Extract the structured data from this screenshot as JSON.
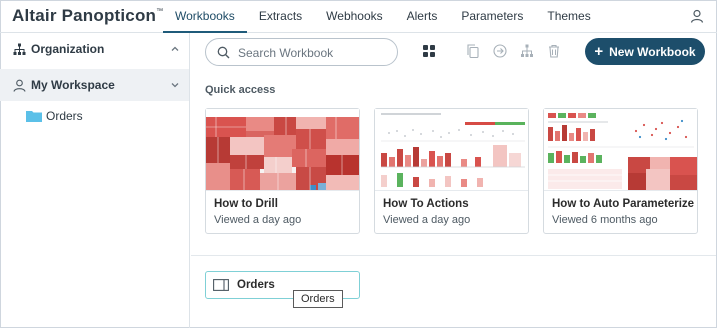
{
  "app": {
    "brand": "Altair Panopticon",
    "trademark": "™"
  },
  "tabs": [
    {
      "label": "Workbooks",
      "active": true
    },
    {
      "label": "Extracts"
    },
    {
      "label": "Webhooks"
    },
    {
      "label": "Alerts"
    },
    {
      "label": "Parameters"
    },
    {
      "label": "Themes"
    }
  ],
  "sidebar": {
    "organization": "Organization",
    "workspace": "My Workspace",
    "folders": [
      {
        "label": "Orders"
      }
    ]
  },
  "toolbar": {
    "search_placeholder": "Search Workbook",
    "new_workbook": "New Workbook",
    "icons": [
      "grid-view-icon",
      "copy-icon",
      "move-icon",
      "hierarchy-icon",
      "delete-icon"
    ]
  },
  "quick_access": {
    "title": "Quick access",
    "cards": [
      {
        "name": "How to Drill",
        "meta": "Viewed a day ago"
      },
      {
        "name": "How To Actions",
        "meta": "Viewed a day ago"
      },
      {
        "name": "How to Auto Parameterize",
        "meta": "Viewed 6 months ago"
      }
    ]
  },
  "folder_card": {
    "label": "Orders"
  },
  "tooltip": {
    "text": "Orders"
  },
  "colors": {
    "accent": "#1d4e6b",
    "folder": "#5bc0e8",
    "highlight": "#7fd0d6"
  }
}
